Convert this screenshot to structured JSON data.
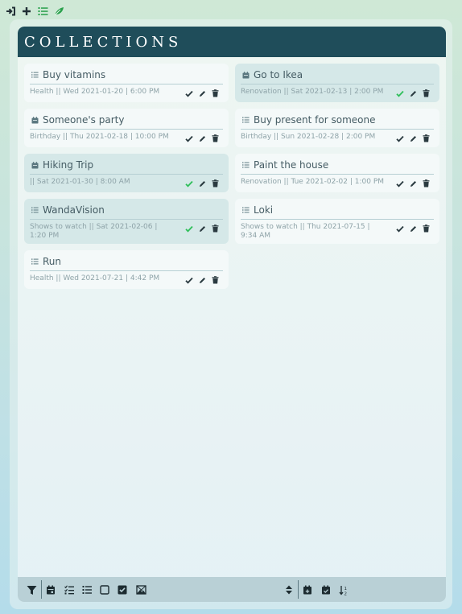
{
  "topbar": {
    "icons": [
      "sign-in-icon",
      "plus-icon",
      "list-icon",
      "leaf-icon"
    ]
  },
  "header": {
    "title": "COLLECTIONS"
  },
  "colors": {
    "header_bg": "#1f4d5a",
    "check_done": "#2fbf5a",
    "icon_dark": "#2a3a40",
    "topbar_green": "#27a04a"
  },
  "cards": [
    {
      "name": "Buy vitamins",
      "icon": "list-icon",
      "meta": "Health || Wed 2021-01-20 | 6:00 PM",
      "done": false,
      "shaded": false
    },
    {
      "name": "Go to Ikea",
      "icon": "calendar-icon",
      "meta": "Renovation || Sat 2021-02-13 | 2:00 PM",
      "done": true,
      "shaded": true
    },
    {
      "name": "Someone's party",
      "icon": "calendar-icon",
      "meta": "Birthday || Thu 2021-02-18 | 10:00 PM",
      "done": false,
      "shaded": false
    },
    {
      "name": "Buy present for someone",
      "icon": "list-icon",
      "meta": "Birthday || Sun 2021-02-28 | 2:00 PM",
      "done": false,
      "shaded": false
    },
    {
      "name": "Hiking Trip",
      "icon": "calendar-icon",
      "meta": "|| Sat 2021-01-30 | 8:00 AM",
      "done": true,
      "shaded": true
    },
    {
      "name": "Paint the house",
      "icon": "list-icon",
      "meta": "Renovation || Tue 2021-02-02 | 1:00 PM",
      "done": false,
      "shaded": false
    },
    {
      "name": "WandaVision",
      "icon": "list-icon",
      "meta": "Shows to watch || Sat 2021-02-06 | 1:20 PM",
      "done": true,
      "shaded": true
    },
    {
      "name": "Loki",
      "icon": "list-icon",
      "meta": "Shows to watch || Thu 2021-07-15 | 9:34 AM",
      "done": false,
      "shaded": false
    },
    {
      "name": "Run",
      "icon": "list-icon",
      "meta": "Health || Wed 2021-07-21 | 4:42 PM",
      "done": false,
      "shaded": false
    }
  ],
  "bottombar": {
    "left_icons": [
      "filter-icon",
      "calendar-icon",
      "checklist-icon",
      "list-icon",
      "square-icon",
      "checked-square-icon",
      "image-icon"
    ],
    "right_icons": [
      "sort-icon",
      "calendar-plus-icon",
      "calendar-check-icon",
      "sort-alpha-icon"
    ]
  }
}
